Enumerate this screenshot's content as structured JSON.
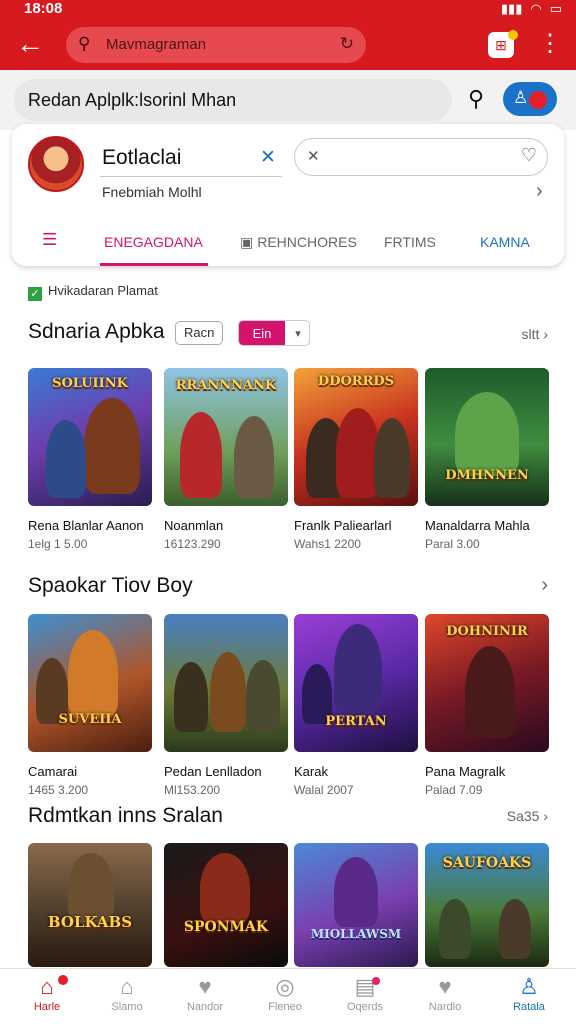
{
  "status_bar": {
    "time": "18:08",
    "battery_icon": "battery-icon",
    "wifi_icon": "wifi-icon",
    "signal_icon": "signal-icon"
  },
  "top_bar": {
    "url_text": "Mavmagraman",
    "accent_color": "#d71920"
  },
  "search": {
    "placeholder": "Redan Aplplk:lsorinl Mhan"
  },
  "profile": {
    "name": "Eotlaclai",
    "subtitle": "Fnebmiah Molhl",
    "tabs": [
      {
        "label": "ENEGAGDANA",
        "active": true
      },
      {
        "label": "REHNCHORES",
        "active": false
      },
      {
        "label": "FRTIMS",
        "active": false
      },
      {
        "label": "KAMNA",
        "active": false
      }
    ]
  },
  "verified_text": "Hvikadaran Plamat",
  "sections": [
    {
      "title": "Sdnaria Apbka",
      "chip_outline": "Racn",
      "chip_split": "Ein",
      "right_label": "sltt",
      "items": [
        {
          "title": "Rena Blanlar Aanon",
          "meta": "1elg 1 5.00",
          "art": "SOLUIINK"
        },
        {
          "title": "Noanmlan",
          "meta": "16123.290",
          "art": "RRANNNANK"
        },
        {
          "title": "Franlk Paliearlarl",
          "meta": "Wahs1 2200",
          "art": "DDORRDS"
        },
        {
          "title": "Manaldarra Mahla",
          "meta": "Paral 3.00",
          "art": "DMHNNEN"
        }
      ]
    },
    {
      "title": "Spaokar Tiov Boy",
      "right_label": "",
      "items": [
        {
          "title": "Camarai",
          "meta": "1465 3.200",
          "art": "SUVEIIA"
        },
        {
          "title": "Pedan Lenlladon",
          "meta": "Ml153.200",
          "art": ""
        },
        {
          "title": "Karak",
          "meta": "Walal 2007",
          "art": "PERTAN"
        },
        {
          "title": "Pana Magralk",
          "meta": "Palad 7.09",
          "art": "DOHNINIR"
        }
      ]
    },
    {
      "title": "Rdmtkan inns Sralan",
      "right_label": "Sa35",
      "items": [
        {
          "art": "BOLKABS"
        },
        {
          "art": "SPONMAK"
        },
        {
          "art": "MIOLLAWSM"
        },
        {
          "art": "SAUFOAKS"
        }
      ]
    }
  ],
  "bottom_nav": [
    {
      "label": "Harle",
      "icon": "home-icon"
    },
    {
      "label": "Slamo",
      "icon": "store-icon"
    },
    {
      "label": "Nandor",
      "icon": "heart-icon"
    },
    {
      "label": "Fleneo",
      "icon": "gamepad-icon"
    },
    {
      "label": "Oqerds",
      "icon": "chat-icon"
    },
    {
      "label": "Nardlo",
      "icon": "favorite-icon"
    },
    {
      "label": "Ratala",
      "icon": "profile-icon"
    }
  ]
}
